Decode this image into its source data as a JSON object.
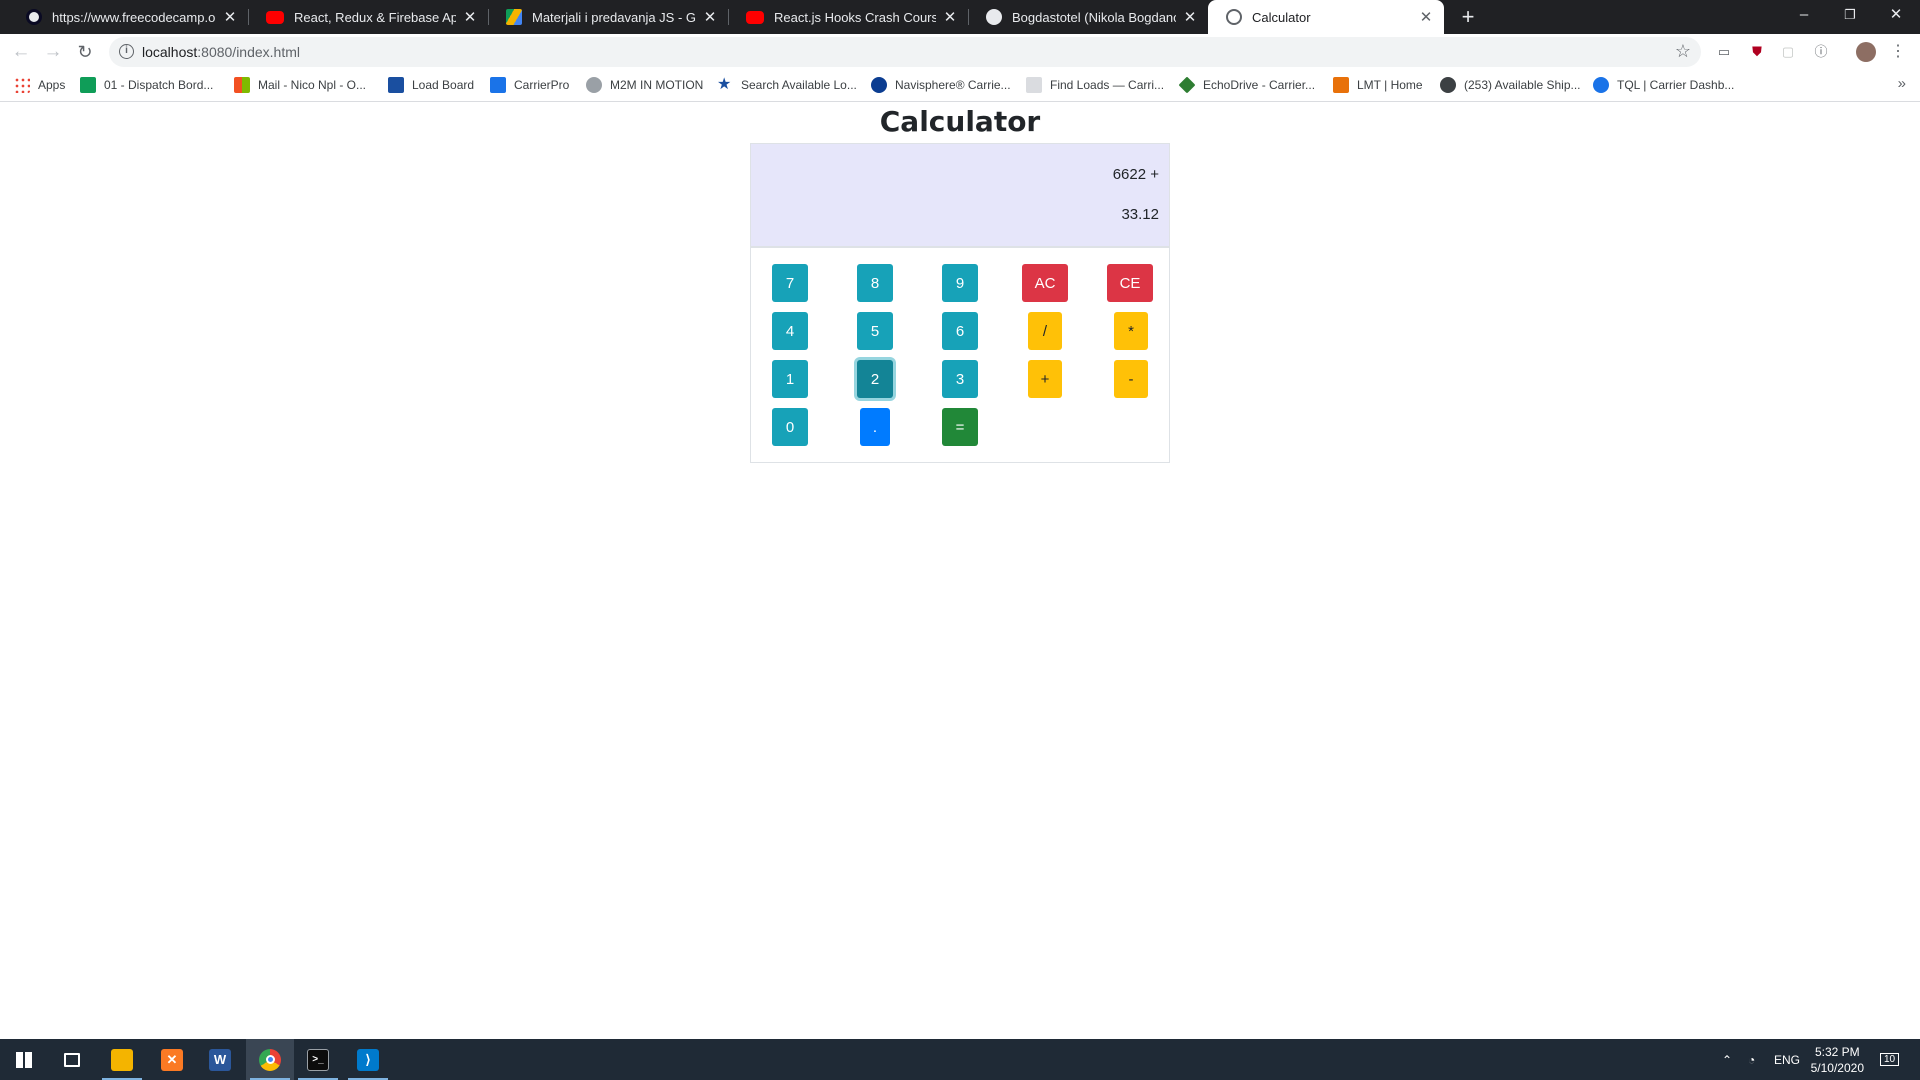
{
  "browser": {
    "tabs": [
      {
        "title": "https://www.freecodecamp.org/l",
        "favicon": "freecodecamp-icon",
        "color": "#0a0a23",
        "active": false
      },
      {
        "title": "React, Redux & Firebase App Tut",
        "favicon": "youtube-icon",
        "color": "#ff0000",
        "active": false
      },
      {
        "title": "Materjali i predavanja JS - Googl",
        "favicon": "google-drive-icon",
        "color": "#0f9d58",
        "active": false
      },
      {
        "title": "React.js Hooks Crash Course - Yo",
        "favicon": "youtube-icon",
        "color": "#ff0000",
        "active": false
      },
      {
        "title": "Bogdastotel (Nikola Bogdanovic)",
        "favicon": "github-icon",
        "color": "#e8eaed",
        "active": false
      },
      {
        "title": "Calculator",
        "favicon": "globe-icon",
        "color": "#5f6368",
        "active": true
      }
    ],
    "new_tab_label": "+",
    "window_controls": {
      "minimize": "–",
      "maximize": "❐",
      "close": "✕"
    },
    "address": {
      "host": "localhost",
      "rest": ":8080/index.html"
    },
    "bookmarks": [
      {
        "label": "Apps",
        "icon": "apps-grid-icon",
        "color": "#4285f4"
      },
      {
        "label": "01 - Dispatch Bord...",
        "icon": "sheets-icon",
        "color": "#0f9d58"
      },
      {
        "label": "Mail - Nico Npl - O...",
        "icon": "microsoft-icon",
        "color": "#f25022"
      },
      {
        "label": "Load Board",
        "icon": "load-board-icon",
        "color": "#1a4fa0"
      },
      {
        "label": "CarrierPro",
        "icon": "carrierpro-icon",
        "color": "#1a73e8"
      },
      {
        "label": "M2M IN MOTION",
        "icon": "m2m-icon",
        "color": "#3c4043"
      },
      {
        "label": "Search Available Lo...",
        "icon": "star-icon",
        "color": "#1a4fa0"
      },
      {
        "label": "Navisphere® Carrie...",
        "icon": "navisphere-icon",
        "color": "#0b3d91"
      },
      {
        "label": "Find Loads — Carri...",
        "icon": "xpo-icon",
        "color": "#9aa0a6"
      },
      {
        "label": "EchoDrive - Carrier...",
        "icon": "echo-icon",
        "color": "#2e7d32"
      },
      {
        "label": "LMT | Home",
        "icon": "lmt-icon",
        "color": "#e8710a"
      },
      {
        "label": "(253) Available Ship...",
        "icon": "globe-icon",
        "color": "#3c4043"
      },
      {
        "label": "TQL | Carrier Dashb...",
        "icon": "tql-icon",
        "color": "#1a73e8"
      }
    ]
  },
  "calculator": {
    "title": "Calculator",
    "formula": "6622 +",
    "value": "33.12",
    "keys": {
      "k7": "7",
      "k8": "8",
      "k9": "9",
      "ac": "AC",
      "ce": "CE",
      "k4": "4",
      "k5": "5",
      "k6": "6",
      "div": "/",
      "mul": "*",
      "k1": "1",
      "k2": "2",
      "k3": "3",
      "add": "+",
      "sub": "-",
      "k0": "0",
      "dot": ".",
      "eq": "="
    },
    "colors": {
      "number": "#17a2b8",
      "clear": "#dc3545",
      "operator": "#ffc107",
      "decimal": "#007bff",
      "equals": "#218838",
      "display_bg": "#e6e6fa"
    }
  },
  "taskbar": {
    "apps": [
      "windows-start-icon",
      "task-view-icon",
      "file-explorer-icon",
      "xampp-icon",
      "word-icon",
      "chrome-icon",
      "terminal-icon",
      "vscode-icon"
    ],
    "language": "ENG",
    "time": "5:32 PM",
    "date": "5/10/2020",
    "notifications": "10"
  }
}
